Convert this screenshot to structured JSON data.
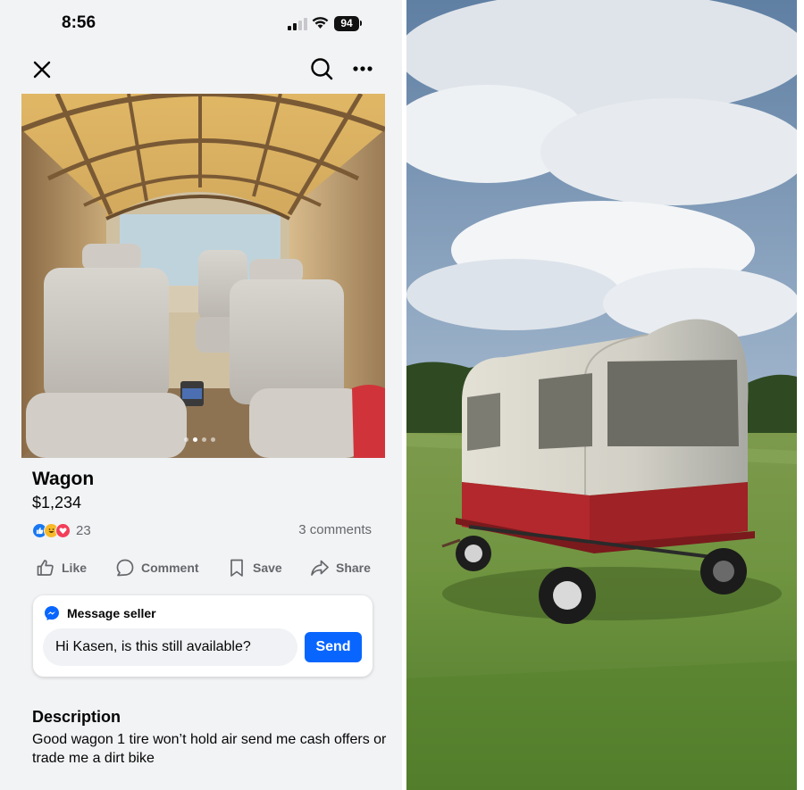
{
  "status_bar": {
    "time": "8:56",
    "battery": "94"
  },
  "listing": {
    "title": "Wagon",
    "price": "$1,234",
    "reaction_count": "23",
    "comments": "3 comments",
    "photo_count": 4,
    "photo_active_index": 1
  },
  "actions": {
    "like": "Like",
    "comment": "Comment",
    "save": "Save",
    "share": "Share"
  },
  "message_seller": {
    "header": "Message seller",
    "input_value": "Hi Kasen, is this still available?",
    "send_label": "Send"
  },
  "description": {
    "heading": "Description",
    "text": "Good wagon 1 tire won’t hold air send me cash offers or trade me a dirt bike"
  },
  "icons": {
    "close": "close-icon",
    "search": "search-icon",
    "more": "more-icon",
    "like": "thumbs-up-icon",
    "comment": "comment-bubble-icon",
    "save": "bookmark-icon",
    "share": "share-arrow-icon",
    "messenger": "messenger-icon"
  },
  "colors": {
    "accent": "#0866ff",
    "background": "#f2f3f5",
    "secondary_text": "#65676b"
  }
}
